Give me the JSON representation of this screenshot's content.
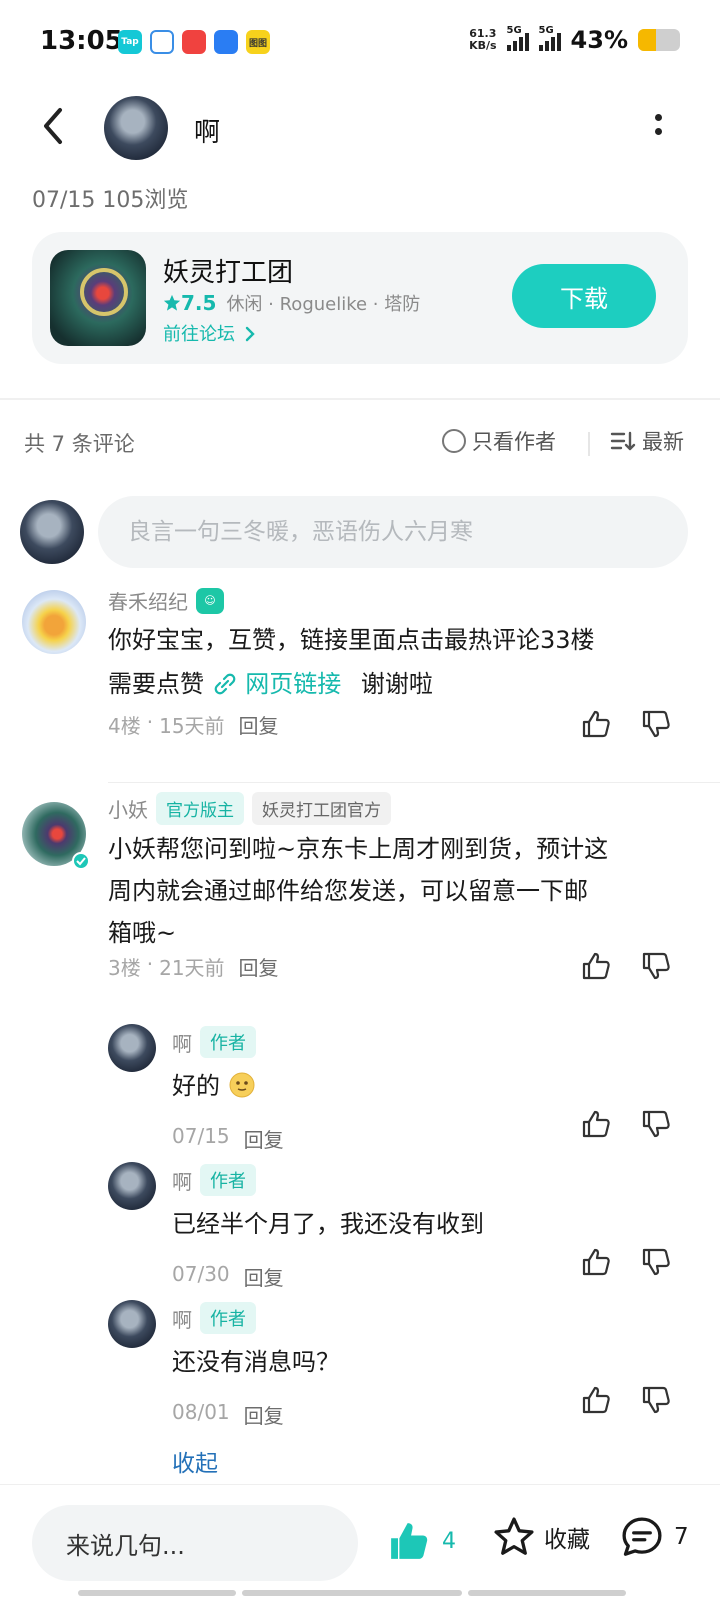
{
  "status_bar": {
    "time": "13:05",
    "apps": [
      "Tap",
      "",
      "",
      "",
      "图图"
    ],
    "net_speed_value": "61.3",
    "net_speed_unit": "KB/s",
    "sig1": "5G",
    "sig2": "5G",
    "battery_text": "43%",
    "battery_level": 0.43
  },
  "header": {
    "username": "啊"
  },
  "post_meta": "07/15  105浏览",
  "game": {
    "title": "妖灵打工团",
    "rating": "7.5",
    "tags": "休闲 · Roguelike · 塔防",
    "forum_link": "前往论坛",
    "download_label": "下载"
  },
  "comments_header": {
    "count": "共 7 条评论",
    "only_author": "只看作者",
    "sort": "最新"
  },
  "comment_input": {
    "placeholder": "良言一句三冬暖，恶语伤人六月寒"
  },
  "comments": [
    {
      "author": "春禾绍纪",
      "text_line1": "你好宝宝，互赞，链接里面点击最热评论33楼",
      "text_line2_prefix": "需要点赞",
      "link_text": "网页链接",
      "text_line2_suffix": "谢谢啦",
      "floor": "4楼",
      "time": "15天前",
      "reply": "回复"
    },
    {
      "author": "小妖",
      "tag_official": "官方版主",
      "tag_game": "妖灵打工团官方",
      "text_l1": "小妖帮您问到啦~京东卡上周才刚到货，预计这",
      "text_l2": "周内就会通过邮件给您发送，可以留意一下邮",
      "text_l3": "箱哦~",
      "floor": "3楼",
      "time": "21天前",
      "reply": "回复"
    }
  ],
  "replies": [
    {
      "author": "啊",
      "tag": "作者",
      "text": "好的",
      "date": "07/15",
      "reply": "回复"
    },
    {
      "author": "啊",
      "tag": "作者",
      "text": "已经半个月了，我还没有收到",
      "date": "07/30",
      "reply": "回复"
    },
    {
      "author": "啊",
      "tag": "作者",
      "text": "还没有消息吗？",
      "date": "08/01",
      "reply": "回复"
    }
  ],
  "collapse_label": "收起",
  "bottom_bar": {
    "input_placeholder": "来说几句...",
    "like_count": "4",
    "favorite_label": "收藏",
    "comment_count": "7"
  },
  "colors": {
    "accent": "#1dcec0",
    "link": "#16b9ad",
    "collapse": "#2471b8"
  }
}
